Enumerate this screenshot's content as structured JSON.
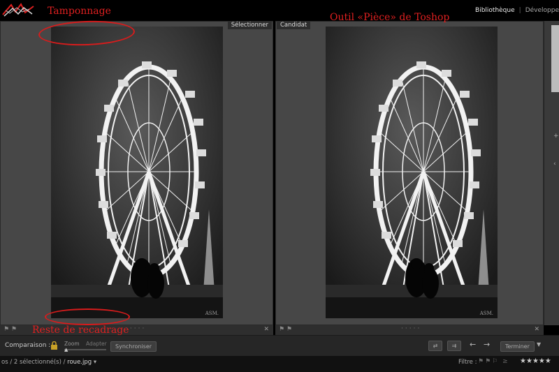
{
  "header": {
    "modules": [
      "Bibliothèque",
      "Développe"
    ],
    "module_separator": "|"
  },
  "panes": {
    "select_label": "Sélectionner",
    "candidate_label": "Candidat",
    "watermark": "ASM."
  },
  "annotations": {
    "top_left": "Tamponnage",
    "top_right": "Outil «Pièce» de Toshop",
    "bottom_left": "Reste de recadrage"
  },
  "toolbar": {
    "comparison_label": "Comparaison :",
    "zoom_label": "Zoom",
    "fit_label": "Adapter",
    "sync_button": "Synchroniser",
    "done_button": "Terminer"
  },
  "statusbar": {
    "path_prefix": "os / 2 sélectionné(s) /",
    "file": "roue.jpg",
    "filter_label": "Filtre :"
  },
  "icons": [
    "logo-icon",
    "lock-icon",
    "flag-icon",
    "close-icon",
    "swap-icon",
    "make-select-icon",
    "arrow-left-icon",
    "arrow-right-icon",
    "menu-chevron-icon",
    "star-icon"
  ],
  "colors": {
    "annotation": "#e02020",
    "pane_bg": "#474747",
    "toolbar_bg": "#262626"
  }
}
